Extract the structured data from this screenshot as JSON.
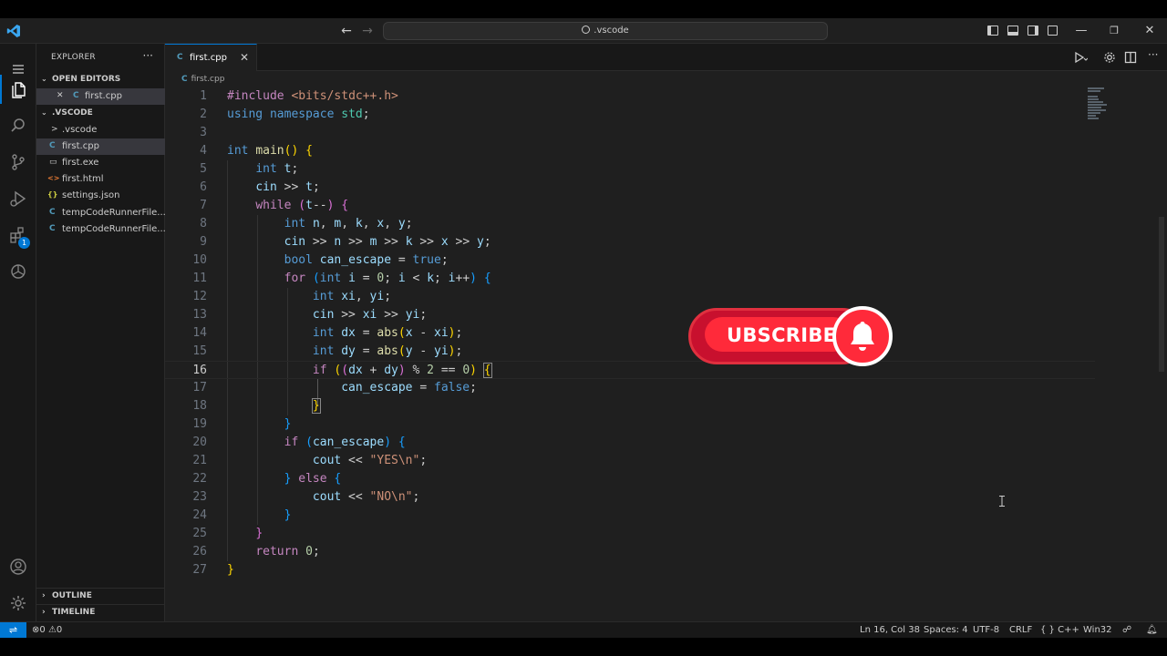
{
  "titlebar": {
    "search_text": ".vscode",
    "back_glyph": "←",
    "forward_glyph": "→",
    "minimize_glyph": "—",
    "restore_glyph": "❐",
    "close_glyph": "✕"
  },
  "activity_bar": {
    "extensions_badge": "1"
  },
  "sidebar": {
    "header": "EXPLORER",
    "more": "···",
    "open_editors_label": "OPEN EDITORS",
    "open_editors": [
      {
        "icon": "C",
        "label": "first.cpp"
      }
    ],
    "folder_label": ".VSCODE",
    "items": [
      {
        "icon": ">",
        "label": ".vscode",
        "type": "folder"
      },
      {
        "icon": "C",
        "label": "first.cpp",
        "type": "cpp"
      },
      {
        "icon": "▭",
        "label": "first.exe",
        "type": "exe"
      },
      {
        "icon": "<>",
        "label": "first.html",
        "type": "html"
      },
      {
        "icon": "{}",
        "label": "settings.json",
        "type": "json"
      },
      {
        "icon": "C",
        "label": "tempCodeRunnerFile....",
        "type": "cpp"
      },
      {
        "icon": "C",
        "label": "tempCodeRunnerFile....",
        "type": "cpp"
      }
    ],
    "outline_label": "OUTLINE",
    "timeline_label": "TIMELINE"
  },
  "editor": {
    "tab_label": "first.cpp",
    "tab_icon": "C",
    "breadcrumb": "first.cpp",
    "current_line": 16,
    "line_numbers": [
      "1",
      "2",
      "3",
      "4",
      "5",
      "6",
      "7",
      "8",
      "9",
      "10",
      "11",
      "12",
      "13",
      "14",
      "15",
      "16",
      "17",
      "18",
      "19",
      "20",
      "21",
      "22",
      "23",
      "24",
      "25",
      "26",
      "27"
    ]
  },
  "overlay": {
    "subscribe_text": "UBSCRIBE"
  },
  "statusbar": {
    "remote_glyph": "⇌",
    "errors": "0",
    "warnings": "0",
    "position": "Ln 16, Col 38",
    "spaces": "Spaces: 4",
    "encoding": "UTF-8",
    "eol": "CRLF",
    "language": "C++",
    "language_icon": "{ }",
    "platform": "Win32"
  },
  "colors": {
    "accent": "#0078d4",
    "editor_bg": "#1f1f1f",
    "sidebar_bg": "#181818",
    "subscribe_red": "#ff2a3a"
  }
}
